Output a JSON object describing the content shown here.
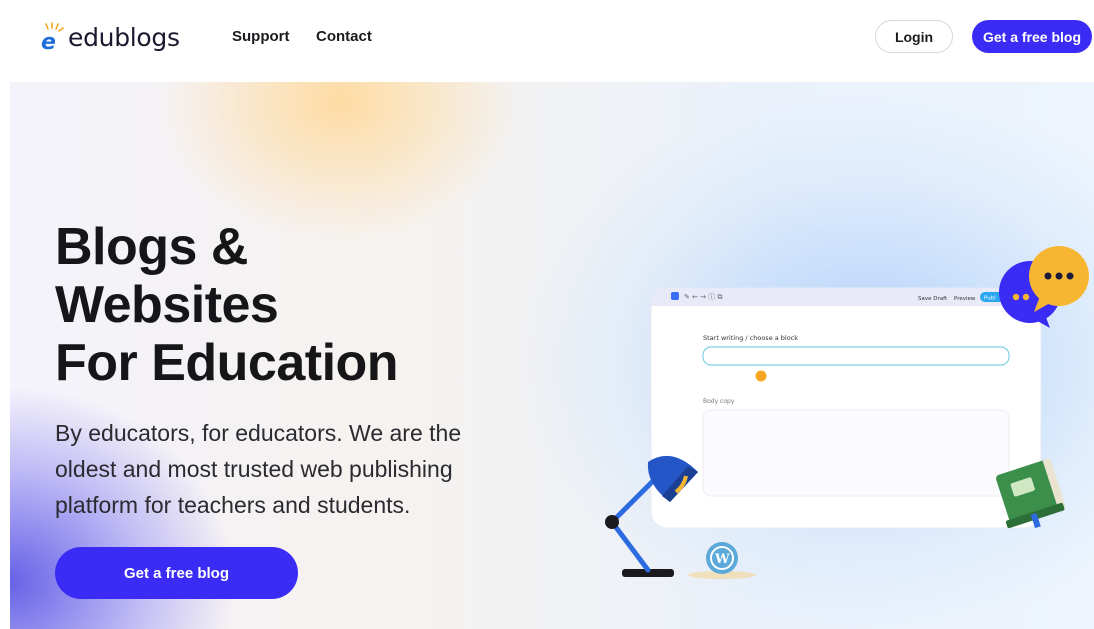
{
  "brand": {
    "name": "edublogs"
  },
  "nav": {
    "links": [
      {
        "label": "Support"
      },
      {
        "label": "Contact"
      }
    ],
    "login_label": "Login",
    "cta_label": "Get a free blog"
  },
  "hero": {
    "headline_lines": [
      "Blogs &",
      "Websites",
      "For Education"
    ],
    "subtext": "By educators, for educators. We are the oldest and most trusted web publishing platform for teachers and students.",
    "cta_label": "Get a free blog"
  },
  "editor_mock": {
    "toolbar": {
      "save_draft": "Save Draft",
      "preview": "Preview",
      "publish": "Publ"
    },
    "title_label": "Start writing / choose a block",
    "body_label": "Body copy"
  },
  "colors": {
    "accent": "#3b2cf5",
    "chat_yellow": "#f6b632",
    "book_green": "#3b8f4a",
    "lamp_blue": "#2d6be0"
  },
  "icons": [
    "edublogs-logo-icon",
    "chat-bubbles-icon",
    "desk-lamp-icon",
    "book-icon",
    "wordpress-icon"
  ]
}
